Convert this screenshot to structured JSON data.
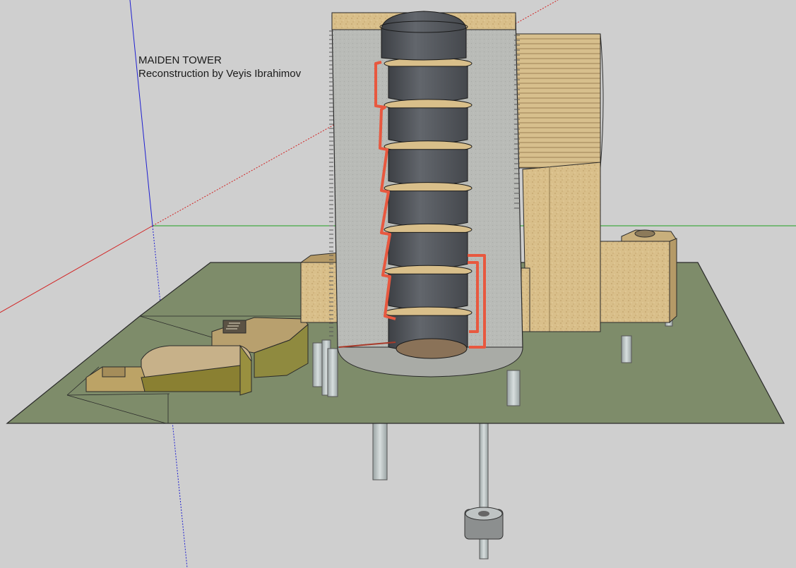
{
  "annotation": {
    "title": "MAIDEN TOWER",
    "subtitle": "Reconstruction by Veyis Ibrahimov"
  },
  "colors": {
    "background": "#cfcfcf",
    "ground": "#7e8c6a",
    "stone": "#d9bf8a",
    "stone_shadow": "#b59a67",
    "tower_wall": "#b8bab6",
    "cylinder": "#55585e",
    "pipe": "#e8583f",
    "axis_red": "#d22222",
    "axis_green": "#20a020",
    "axis_blue": "#1f1fd0"
  },
  "model": {
    "name": "maiden-tower-reconstruction",
    "tower_levels": 7
  }
}
